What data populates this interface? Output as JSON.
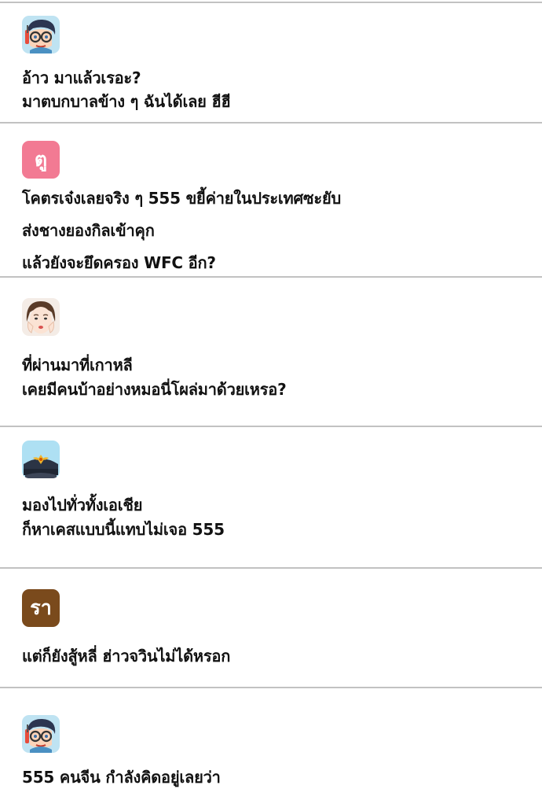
{
  "colors": {
    "divider": "#c2c2c2",
    "text": "#111111",
    "avatar_pink": "#f27a93",
    "avatar_brown": "#7a4a1c"
  },
  "comments": [
    {
      "avatar_icon": "glasses-boy-avatar-icon",
      "lines": [
        "อ้าว มาแล้วเรอะ?",
        "มาตบกบาลข้าง ๆ ฉันได้เลย ฮีฮี"
      ]
    },
    {
      "avatar_text": "ตู",
      "lines": [
        "โคตรเจ๋งเลยจริง ๆ 555 ขยี้ค่ายในประเทศซะยับ",
        "ส่งชางยองกิลเข้าคุก",
        "แล้วยังจะยึดครอง WFC อีก?"
      ]
    },
    {
      "avatar_icon": "girl-face-avatar-icon",
      "lines": [
        "ที่ผ่านมาที่เกาหลี",
        "เคยมีคนบ้าอย่างหมอนี่โผล่มาด้วยเหรอ?"
      ]
    },
    {
      "avatar_icon": "police-cap-avatar-icon",
      "lines": [
        "มองไปทั่วทั้งเอเชีย",
        "ก็หาเคสแบบนี้แทบไม่เจอ 555"
      ]
    },
    {
      "avatar_text": "รา",
      "lines": [
        "แต่ก็ยังสู้หลี่ ฮ่าวจวินไม่ได้หรอก"
      ]
    },
    {
      "avatar_icon": "glasses-boy-avatar-icon",
      "lines": [
        "555 คนจีน กำลังคิดอยู่เลยว่า"
      ]
    }
  ]
}
